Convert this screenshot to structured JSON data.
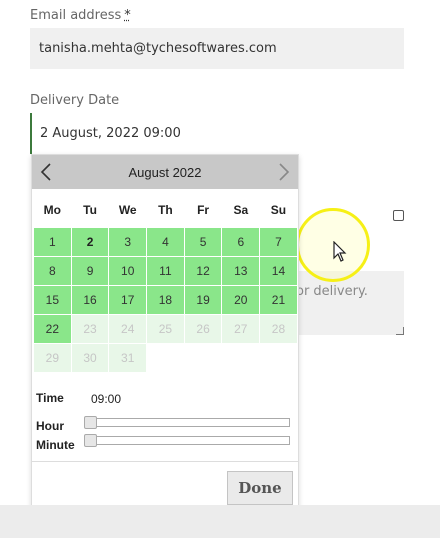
{
  "email": {
    "label": "Email address",
    "required_mark": "*",
    "value": "tanisha.mehta@tychesoftwares.com"
  },
  "delivery": {
    "label": "Delivery Date",
    "value": "2 August, 2022 09:00"
  },
  "notes_field": {
    "visible_text": "or delivery."
  },
  "datepicker": {
    "month_title": "August 2022",
    "prev_icon": "chevron-left-icon",
    "next_icon": "chevron-right-icon",
    "weekdays": [
      "Mo",
      "Tu",
      "We",
      "Th",
      "Fr",
      "Sa",
      "Su"
    ],
    "weeks": [
      [
        {
          "d": "1",
          "s": "on"
        },
        {
          "d": "2",
          "s": "sel"
        },
        {
          "d": "3",
          "s": "on"
        },
        {
          "d": "4",
          "s": "on"
        },
        {
          "d": "5",
          "s": "on"
        },
        {
          "d": "6",
          "s": "on"
        },
        {
          "d": "7",
          "s": "on"
        }
      ],
      [
        {
          "d": "8",
          "s": "on"
        },
        {
          "d": "9",
          "s": "on"
        },
        {
          "d": "10",
          "s": "on"
        },
        {
          "d": "11",
          "s": "on"
        },
        {
          "d": "12",
          "s": "on"
        },
        {
          "d": "13",
          "s": "on"
        },
        {
          "d": "14",
          "s": "on"
        }
      ],
      [
        {
          "d": "15",
          "s": "on"
        },
        {
          "d": "16",
          "s": "on"
        },
        {
          "d": "17",
          "s": "on"
        },
        {
          "d": "18",
          "s": "on"
        },
        {
          "d": "19",
          "s": "on"
        },
        {
          "d": "20",
          "s": "on"
        },
        {
          "d": "21",
          "s": "on"
        }
      ],
      [
        {
          "d": "22",
          "s": "on"
        },
        {
          "d": "23",
          "s": "off"
        },
        {
          "d": "24",
          "s": "off"
        },
        {
          "d": "25",
          "s": "off"
        },
        {
          "d": "26",
          "s": "off"
        },
        {
          "d": "27",
          "s": "off"
        },
        {
          "d": "28",
          "s": "off"
        }
      ],
      [
        {
          "d": "29",
          "s": "off"
        },
        {
          "d": "30",
          "s": "off"
        },
        {
          "d": "31",
          "s": "off"
        },
        {
          "d": "",
          "s": "none"
        },
        {
          "d": "",
          "s": "none"
        },
        {
          "d": "",
          "s": "none"
        },
        {
          "d": "",
          "s": "none"
        }
      ]
    ],
    "time_label": "Time",
    "time_value": "09:00",
    "hour_label": "Hour",
    "minute_label": "Minute",
    "hour_level": 0,
    "minute_level": 0,
    "done_label": "Done"
  },
  "colors": {
    "available_day": "#8ae68a",
    "unavailable_day": "#e8f7e8",
    "header_bg": "#c8c8c8",
    "cursor_highlight": "#f6f016"
  }
}
